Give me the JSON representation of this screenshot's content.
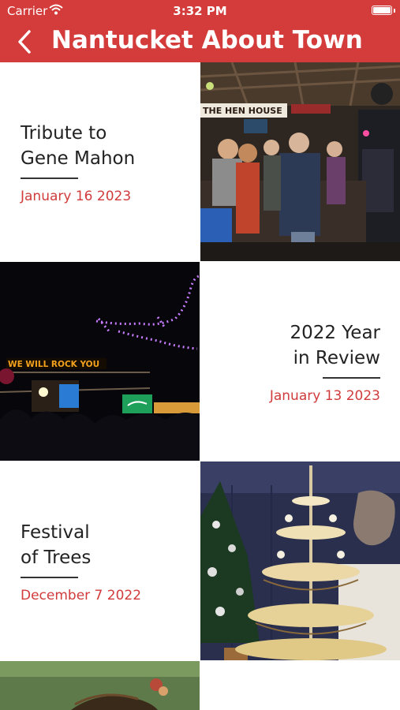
{
  "status_bar": {
    "carrier": "Carrier",
    "time": "3:32 PM"
  },
  "nav": {
    "title": "Nantucket About Town",
    "back_icon": "chevron-left-icon"
  },
  "colors": {
    "brand": "#d43b3b",
    "date": "#d13b3b"
  },
  "articles": [
    {
      "title_line1": "Tribute to",
      "title_line2": "Gene Mahon",
      "date": "January 16 2023",
      "photo_sign": "THE HEN HOUSE"
    },
    {
      "title_line1": "2022 Year",
      "title_line2": "in Review",
      "date": "January 13 2023",
      "photo_sign": "WE WILL ROCK YOU"
    },
    {
      "title_line1": "Festival",
      "title_line2": "of Trees",
      "date": "December 7 2022"
    }
  ]
}
